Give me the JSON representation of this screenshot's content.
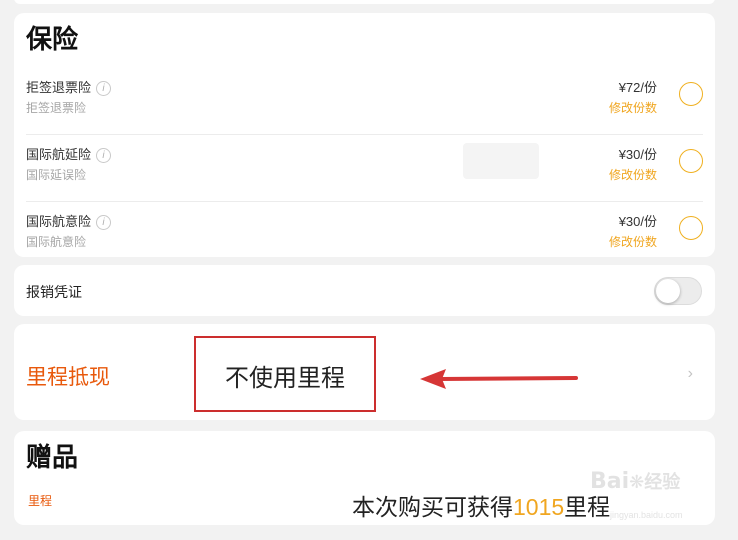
{
  "insurance": {
    "title": "保险",
    "items": [
      {
        "name": "拒签退票险",
        "sub": "拒签退票险",
        "price": "¥72/份",
        "modify": "修改份数"
      },
      {
        "name": "国际航延险",
        "sub": "国际延误险",
        "price": "¥30/份",
        "modify": "修改份数"
      },
      {
        "name": "国际航意险",
        "sub": "国际航意险",
        "price": "¥30/份",
        "modify": "修改份数"
      }
    ]
  },
  "receipt": {
    "label": "报销凭证",
    "enabled": false
  },
  "mileage": {
    "label": "里程抵现",
    "annotation": "不使用里程"
  },
  "gifts": {
    "title": "赠品",
    "item": "里程",
    "caption_prefix": "本次购买可获得",
    "caption_number": "1015",
    "caption_suffix": "里程"
  },
  "watermark": {
    "brand": "Bai",
    "product": "经验",
    "url": "jingyan.baidu.com"
  },
  "colors": {
    "accent_orange": "#f0a620",
    "mileage_red": "#e8590c",
    "annotation_red": "#cc2e2e"
  },
  "icons": {
    "info": "info-circle-icon",
    "radio": "radio-unchecked-icon",
    "chevron": "chevron-right-icon",
    "arrow": "annotation-arrow-icon"
  }
}
